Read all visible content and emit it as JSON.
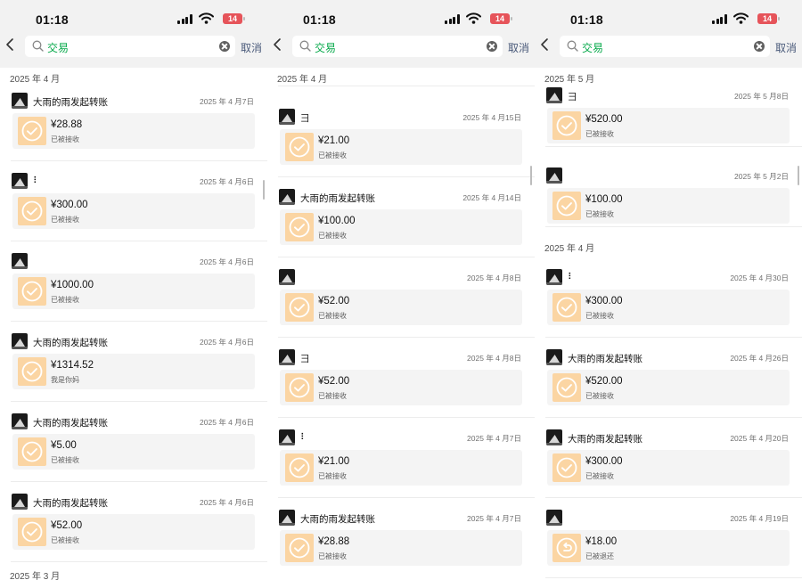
{
  "colors": {
    "search_text": "#07a94b",
    "transfer_icon_bg": "#fbd5a3",
    "battery": "#e6545a",
    "cancel": "#4a5a7a"
  },
  "panels": [
    {
      "time": "01:18",
      "battery": "14",
      "search_query": "交易",
      "cancel_label": "取消",
      "months": [
        "2025 年 4 月",
        "2025 年 3 月"
      ],
      "items": [
        {
          "sender": "大雨的雨发起转账",
          "date": "2025 年 4 月7日",
          "amount": "¥28.88",
          "status": "已被接收",
          "icon": "check-circle-icon"
        },
        {
          "sender": "⠇",
          "date": "2025 年 4 月6日",
          "amount": "¥300.00",
          "status": "已被接收",
          "icon": "check-circle-icon"
        },
        {
          "sender": "",
          "date": "2025 年 4 月6日",
          "amount": "¥1000.00",
          "status": "已被接收",
          "icon": "check-circle-icon"
        },
        {
          "sender": "大雨的雨发起转账",
          "date": "2025 年 4 月6日",
          "amount": "¥1314.52",
          "status": "我是你妈",
          "icon": "check-circle-icon"
        },
        {
          "sender": "大雨的雨发起转账",
          "date": "2025 年 4 月6日",
          "amount": "¥5.00",
          "status": "已被接收",
          "icon": "check-circle-icon"
        },
        {
          "sender": "大雨的雨发起转账",
          "date": "2025 年 4 月6日",
          "amount": "¥52.00",
          "status": "已被接收",
          "icon": "check-circle-icon"
        }
      ]
    },
    {
      "time": "01:18",
      "battery": "14",
      "search_query": "交易",
      "cancel_label": "取消",
      "months": [
        "2025 年 4 月"
      ],
      "items": [
        {
          "sender": "彐",
          "date": "2025 年 4 月15日",
          "amount": "¥21.00",
          "status": "已被接收",
          "icon": "check-circle-icon"
        },
        {
          "sender": "大雨的雨发起转账",
          "date": "2025 年 4 月14日",
          "amount": "¥100.00",
          "status": "已被接收",
          "icon": "check-circle-icon"
        },
        {
          "sender": "",
          "date": "2025 年 4 月8日",
          "amount": "¥52.00",
          "status": "已被接收",
          "icon": "check-circle-icon"
        },
        {
          "sender": "彐",
          "date": "2025 年 4 月8日",
          "amount": "¥52.00",
          "status": "已被接收",
          "icon": "check-circle-icon"
        },
        {
          "sender": "⠇",
          "date": "2025 年 4 月7日",
          "amount": "¥21.00",
          "status": "已被接收",
          "icon": "check-circle-icon"
        },
        {
          "sender": "大雨的雨发起转账",
          "date": "2025 年 4 月7日",
          "amount": "¥28.88",
          "status": "已被接收",
          "icon": "check-circle-icon"
        }
      ]
    },
    {
      "time": "01:18",
      "battery": "14",
      "search_query": "交易",
      "cancel_label": "取消",
      "months": [
        "2025 年 5 月",
        "2025 年 4 月"
      ],
      "items": [
        {
          "sender": "彐",
          "date": "2025 年 5 月8日",
          "amount": "¥520.00",
          "status": "已被接收",
          "icon": "check-circle-icon"
        },
        {
          "sender": "",
          "date": "2025 年 5 月2日",
          "amount": "¥100.00",
          "status": "已被接收",
          "icon": "check-circle-icon"
        },
        {
          "sender": "⠇",
          "date": "2025 年 4 月30日",
          "amount": "¥300.00",
          "status": "已被接收",
          "icon": "check-circle-icon"
        },
        {
          "sender": "大雨的雨发起转账",
          "date": "2025 年 4 月26日",
          "amount": "¥520.00",
          "status": "已被接收",
          "icon": "check-circle-icon"
        },
        {
          "sender": "大雨的雨发起转账",
          "date": "2025 年 4 月20日",
          "amount": "¥300.00",
          "status": "已被接收",
          "icon": "check-circle-icon"
        },
        {
          "sender": "",
          "date": "2025 年 4 月19日",
          "amount": "¥18.00",
          "status": "已被退还",
          "icon": "return-arrow-icon"
        }
      ]
    }
  ]
}
